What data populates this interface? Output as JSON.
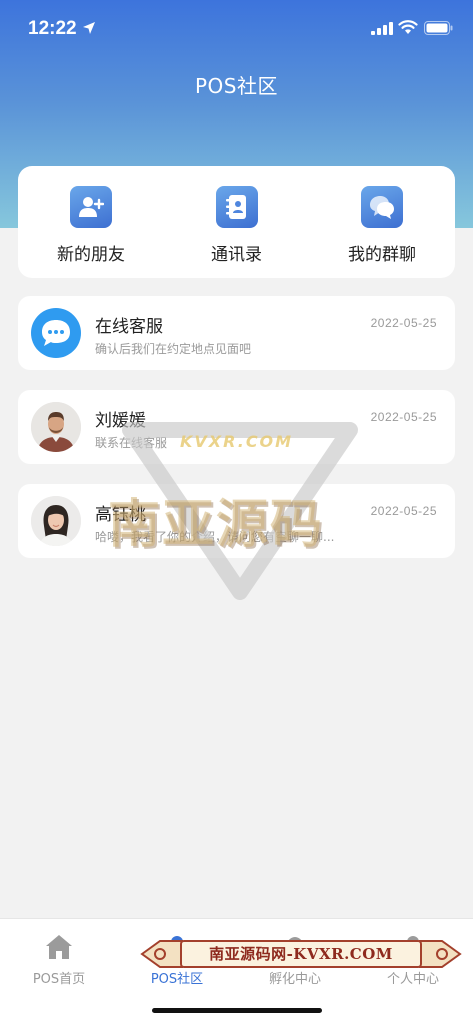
{
  "status_bar": {
    "time": "12:22"
  },
  "header": {
    "title": "POS社区"
  },
  "quick_actions": [
    {
      "label": "新的朋友",
      "icon": "add-user-icon"
    },
    {
      "label": "通讯录",
      "icon": "contacts-book-icon"
    },
    {
      "label": "我的群聊",
      "icon": "group-chat-icon"
    }
  ],
  "chats": [
    {
      "name": "在线客服",
      "preview": "确认后我们在约定地点见面吧",
      "date": "2022-05-25",
      "avatar": "chat-bubble-icon"
    },
    {
      "name": "刘媛媛",
      "preview": "联系在线客服",
      "date": "2022-05-25",
      "avatar": "man-avatar"
    },
    {
      "name": "高钰桃",
      "preview": "哈喽，我看了你的介绍，请问您有空聊一聊...",
      "date": "2022-05-25",
      "avatar": "woman-avatar"
    }
  ],
  "watermark": {
    "main": "南亚源码",
    "sub": "KVXR.COM"
  },
  "tabs": [
    {
      "label": "POS首页",
      "icon": "home-icon",
      "active": false
    },
    {
      "label": "POS社区",
      "icon": "community-icon",
      "active": true
    },
    {
      "label": "孵化中心",
      "icon": "incubator-icon",
      "active": false
    },
    {
      "label": "个人中心",
      "icon": "profile-icon",
      "active": false
    }
  ],
  "banner": {
    "text": "南亚源码网-KVXR.COM"
  },
  "colors": {
    "accent": "#3a73d6",
    "header_top": "#3d74dc",
    "header_bottom": "#86c7dc"
  }
}
